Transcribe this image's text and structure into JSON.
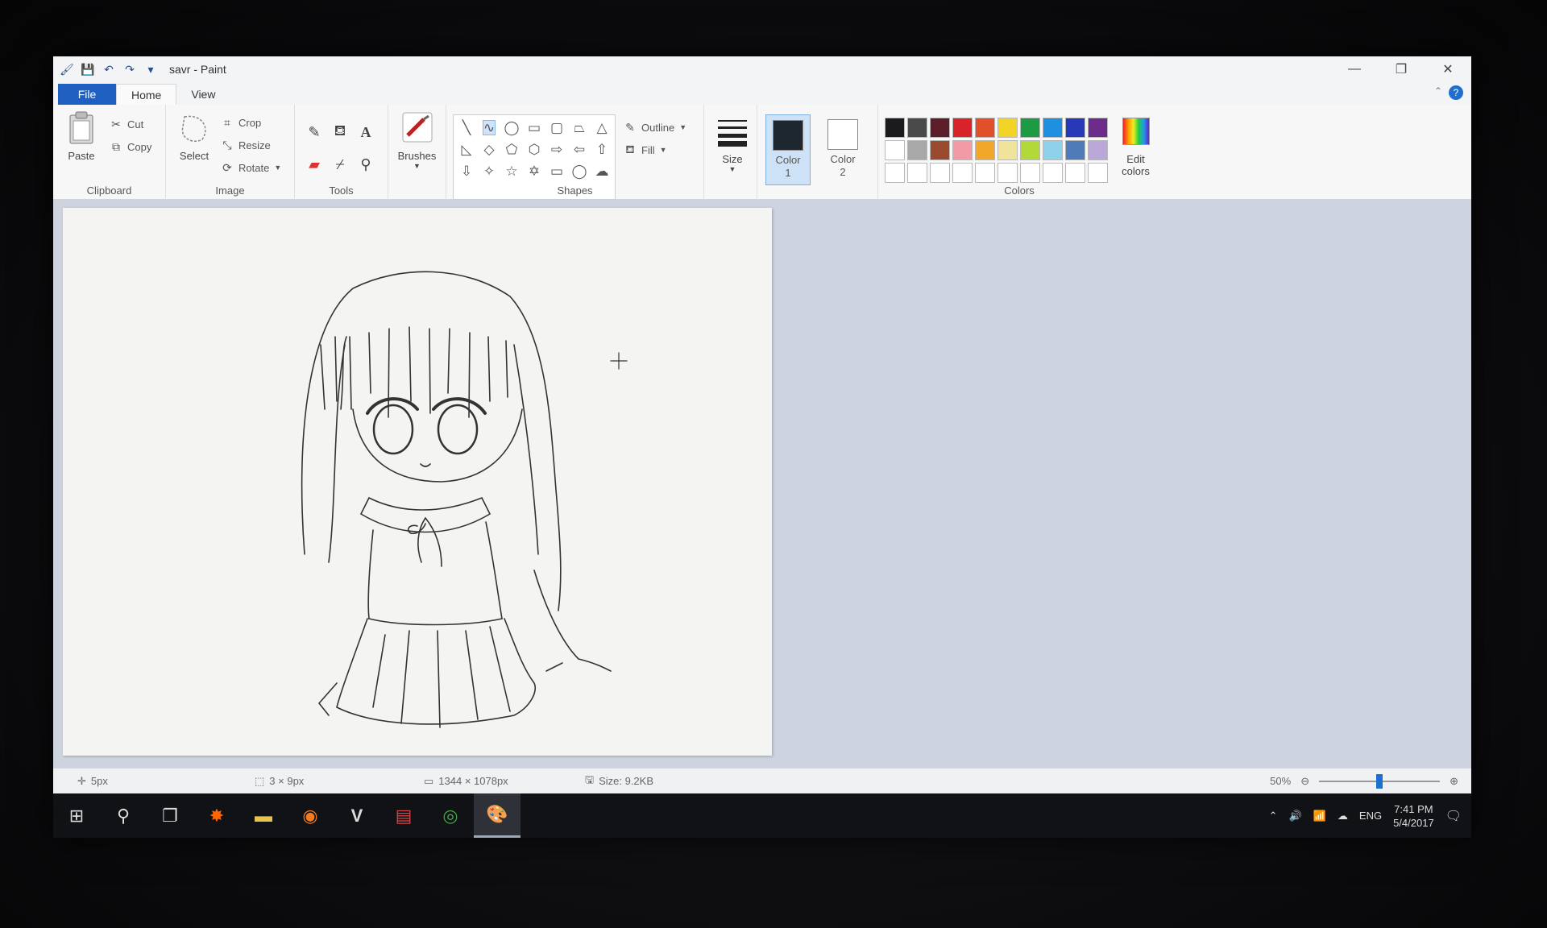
{
  "window": {
    "title": "savr - Paint"
  },
  "quick_access": {
    "icons": [
      "save-icon",
      "undo-icon",
      "redo-icon",
      "customize-icon"
    ]
  },
  "tabs": [
    {
      "label": "File"
    },
    {
      "label": "Home"
    },
    {
      "label": "View"
    }
  ],
  "ribbon": {
    "clipboard": {
      "label": "Clipboard",
      "paste": "Paste",
      "cut": "Cut",
      "copy": "Copy"
    },
    "image": {
      "label": "Image",
      "select": "Select",
      "crop": "Crop",
      "resize": "Resize",
      "rotate": "Rotate"
    },
    "tools": {
      "label": "Tools"
    },
    "brushes": {
      "label": "Brushes"
    },
    "shapes": {
      "label": "Shapes",
      "outline": "Outline",
      "fill": "Fill"
    },
    "size": {
      "label": "Size"
    },
    "colors": {
      "label": "Colors",
      "color1": "Color 1",
      "color2": "Color 2",
      "edit": "Edit colors",
      "color1_value": "#1e2630",
      "color2_value": "#ffffff",
      "palette_row1": [
        "#1b1b1d",
        "#4a4a4a",
        "#5b1e2a",
        "#d8232a",
        "#e2502b",
        "#f2d426",
        "#1e9a45",
        "#1f8fe0",
        "#2738b8",
        "#6d2c8c"
      ],
      "palette_row2": [
        "#ffffff",
        "#a8a8a8",
        "#9a4a2e",
        "#f29aa6",
        "#f2a72a",
        "#f0e49a",
        "#b2d83a",
        "#8fd0ea",
        "#4f7cb8",
        "#b9a8d8"
      ]
    }
  },
  "status": {
    "cursor": "5px",
    "selection": "3 × 9px",
    "dimensions": "1344 × 1078px",
    "size": "Size: 9.2KB",
    "zoom": "50%",
    "zoom_level": 0.5
  },
  "taskbar": {
    "language": "ENG",
    "time": "7:41 PM",
    "date": "5/4/2017"
  }
}
